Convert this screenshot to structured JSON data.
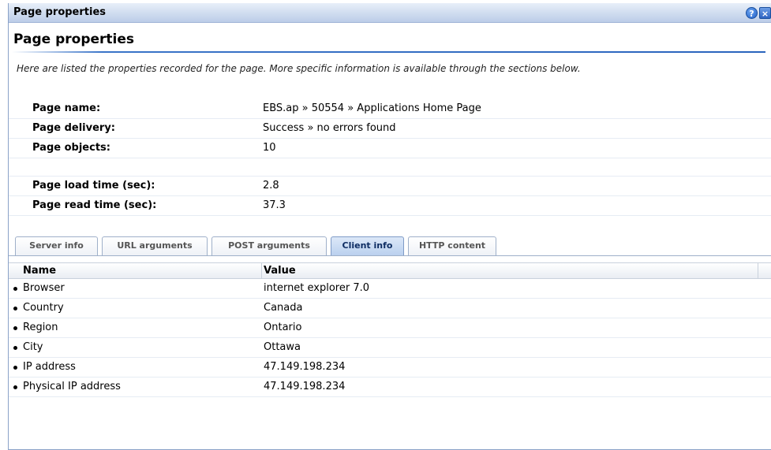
{
  "window": {
    "title": "Page properties",
    "help_glyph": "?",
    "close_glyph": "×"
  },
  "section": {
    "heading": "Page properties",
    "intro": "Here are listed the properties recorded for the page. More specific information is available through the sections below."
  },
  "properties": [
    {
      "label": "Page name:",
      "value": "EBS.ap » 50554 » Applications Home Page"
    },
    {
      "label": "Page delivery:",
      "value": "Success » no errors found"
    },
    {
      "label": "Page objects:",
      "value": "10"
    },
    {
      "label": "Page load time (sec):",
      "value": "2.8"
    },
    {
      "label": "Page read time (sec):",
      "value": "37.3"
    }
  ],
  "tabs": [
    {
      "label": "Server info",
      "active": false
    },
    {
      "label": "URL arguments",
      "active": false
    },
    {
      "label": "POST arguments",
      "active": false
    },
    {
      "label": "Client info",
      "active": true
    },
    {
      "label": "HTTP content",
      "active": false
    }
  ],
  "client_table": {
    "headers": {
      "name": "Name",
      "value": "Value"
    },
    "rows": [
      {
        "name": "Browser",
        "value": "internet explorer 7.0"
      },
      {
        "name": "Country",
        "value": "Canada"
      },
      {
        "name": "Region",
        "value": "Ontario"
      },
      {
        "name": "City",
        "value": "Ottawa"
      },
      {
        "name": "IP address",
        "value": "47.149.198.234"
      },
      {
        "name": "Physical IP address",
        "value": "47.149.198.234"
      }
    ]
  },
  "colors": {
    "titlebar": "#cfdcef",
    "accent_rule": "#2a64bd",
    "active_tab": "#b9cfee"
  }
}
